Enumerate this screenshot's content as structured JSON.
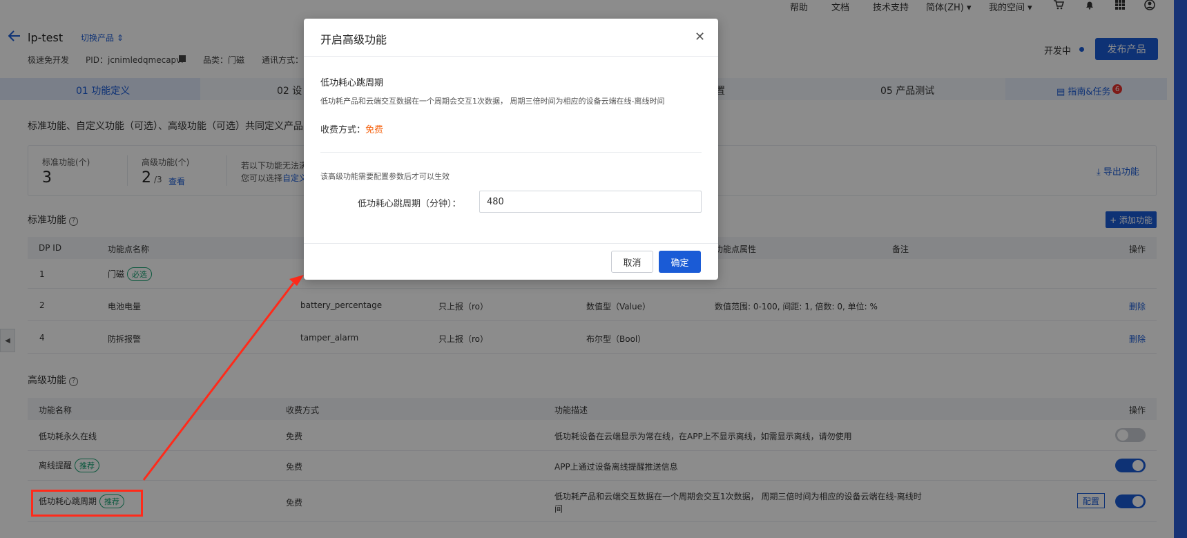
{
  "topnav": {
    "items": [
      "帮助",
      "文档",
      "技术支持",
      "简体(ZH)",
      "我的空间"
    ],
    "icons": [
      "cart-icon",
      "bell-icon",
      "apps-grid-icon",
      "user-avatar-icon"
    ]
  },
  "header": {
    "title": "lp-test",
    "switch_product": "切换产品",
    "meta": {
      "mode": "极速免开发",
      "pid": "PID：jcnimledqmecapvr",
      "category": "品类：门磁",
      "comm": "通讯方式："
    },
    "status": "开发中",
    "publish": "发布产品"
  },
  "steps": {
    "items": [
      "01 功能定义",
      "02 设",
      "置",
      "05 产品测试"
    ],
    "guide": "指南&任务",
    "guide_badge": "6"
  },
  "section_desc": "标准功能、自定义功能（可选）、高级功能（可选）共同定义产品",
  "stats": {
    "standard_label": "标准功能(个)",
    "standard_value": "3",
    "advanced_label": "高级功能(个)",
    "advanced_value": "2",
    "advanced_total": "/3",
    "view": "查看",
    "hint_line1": "若以下功能无法满",
    "hint_line2": "您可以选择",
    "hint_link": "自定义",
    "export": "导出功能"
  },
  "standard": {
    "title": "标准功能",
    "add_button": "+ 添加功能",
    "headers": [
      "DP ID",
      "功能点名称",
      "功能点属性",
      "备注",
      "操作"
    ],
    "rows": [
      {
        "dp": "1",
        "name": "门磁",
        "tag": "必选",
        "code": "",
        "mode": "",
        "type": "",
        "prop": "",
        "action": ""
      },
      {
        "dp": "2",
        "name": "电池电量",
        "tag": "",
        "code": "battery_percentage",
        "mode": "只上报（ro）",
        "type": "数值型（Value）",
        "prop": "数值范围: 0-100, 间距: 1, 倍数: 0, 单位: %",
        "action": "删除"
      },
      {
        "dp": "4",
        "name": "防拆报警",
        "tag": "",
        "code": "tamper_alarm",
        "mode": "只上报（ro）",
        "type": "布尔型（Bool）",
        "prop": "",
        "action": "删除"
      }
    ]
  },
  "advanced": {
    "title": "高级功能",
    "headers": [
      "功能名称",
      "收费方式",
      "功能描述",
      "操作"
    ],
    "rows": [
      {
        "name": "低功耗永久在线",
        "tag": "",
        "fee": "免费",
        "desc": "低功耗设备在云端显示为常在线，在APP上不显示离线，如需显示离线，请勿使用",
        "enabled": false
      },
      {
        "name": "离线提醒",
        "tag": "推荐",
        "fee": "免费",
        "desc": "APP上通过设备离线提醒推送信息",
        "enabled": true
      },
      {
        "name": "低功耗心跳周期",
        "tag": "推荐",
        "fee": "免费",
        "desc": "低功耗产品和云端交互数据在一个周期会交互1次数据， 周期三倍时间为相应的设备云端在线-离线时",
        "desc2": "间",
        "enabled": true,
        "config": "配置"
      }
    ]
  },
  "modal": {
    "title": "开启高级功能",
    "feature_name": "低功耗心跳周期",
    "feature_desc": "低功耗产品和云端交互数据在一个周期会交互1次数据， 周期三倍时间为相应的设备云端在线-离线时间",
    "fee_label": "收费方式：",
    "fee_value": "免费",
    "config_hint": "该高级功能需要配置参数后才可以生效",
    "field_label": "低功耗心跳周期（分钟）：",
    "field_value": "480",
    "cancel": "取消",
    "ok": "确定"
  },
  "colors": {
    "primary": "#1a5bd6",
    "free": "#f5620f",
    "tag_green": "#1aa374",
    "annotation_red": "#ff2a1a"
  }
}
